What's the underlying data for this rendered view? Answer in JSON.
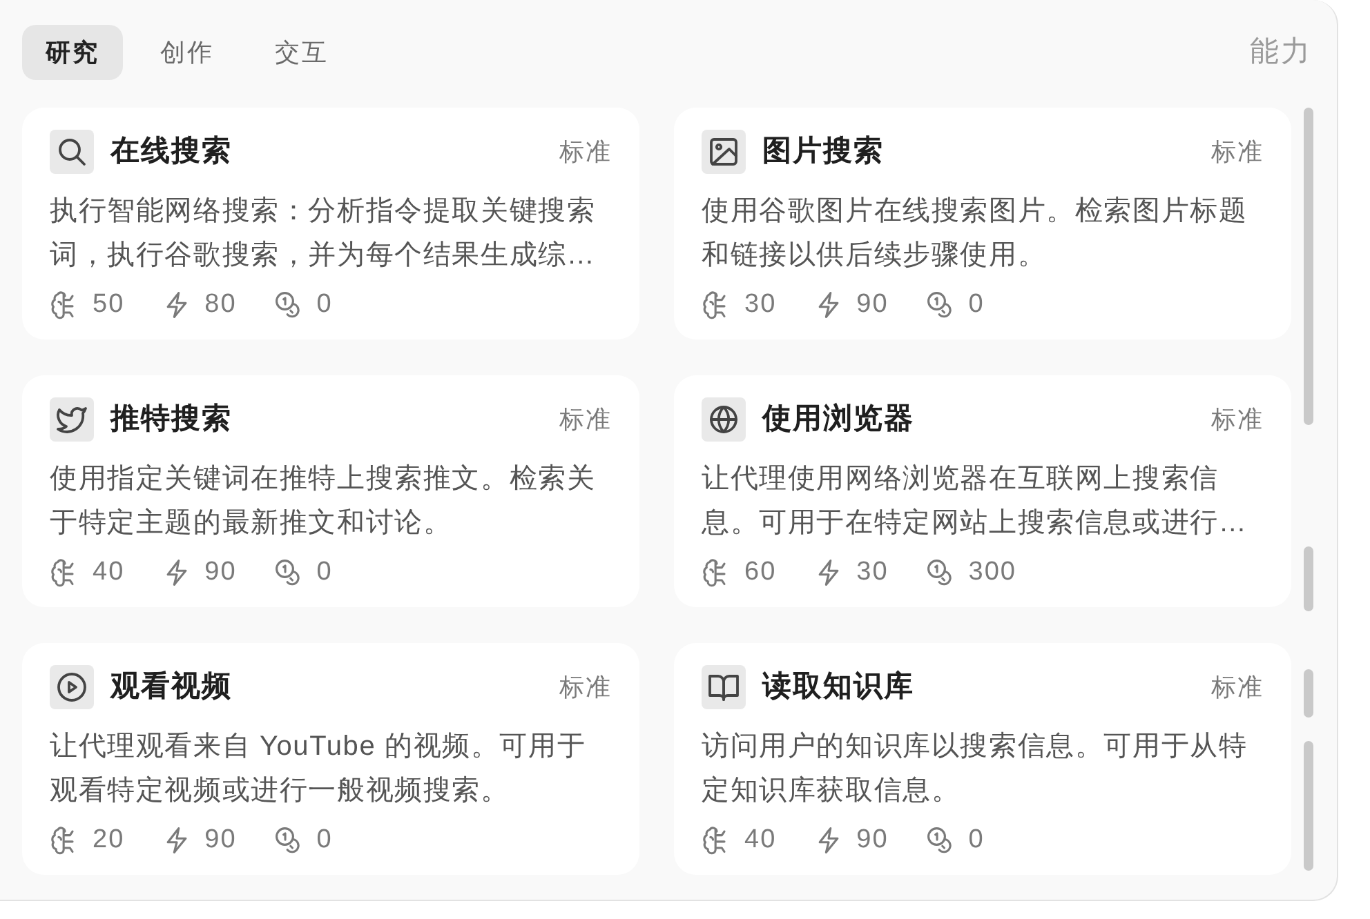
{
  "tabs": [
    {
      "label": "研究",
      "selected": true
    },
    {
      "label": "创作",
      "selected": false
    },
    {
      "label": "交互",
      "selected": false
    }
  ],
  "section_label": "能力",
  "cards": [
    {
      "title": "在线搜索",
      "badge": "标准",
      "description": "执行智能网络搜索：分析指令提取关键搜索词，执行谷歌搜索，并为每个结果生成综…",
      "stats": [
        "50",
        "80",
        "0"
      ]
    },
    {
      "title": "图片搜索",
      "badge": "标准",
      "description": "使用谷歌图片在线搜索图片。检索图片标题和链接以供后续步骤使用。",
      "stats": [
        "30",
        "90",
        "0"
      ]
    },
    {
      "title": "推特搜索",
      "badge": "标准",
      "description": "使用指定关键词在推特上搜索推文。检索关于特定主题的最新推文和讨论。",
      "stats": [
        "40",
        "90",
        "0"
      ]
    },
    {
      "title": "使用浏览器",
      "badge": "标准",
      "description": "让代理使用网络浏览器在互联网上搜索信息。可用于在特定网站上搜索信息或进行…",
      "stats": [
        "60",
        "30",
        "300"
      ]
    },
    {
      "title": "观看视频",
      "badge": "标准",
      "description": "让代理观看来自 YouTube 的视频。可用于观看特定视频或进行一般视频搜索。",
      "stats": [
        "20",
        "90",
        "0"
      ]
    },
    {
      "title": "读取知识库",
      "badge": "标准",
      "description": "访问用户的知识库以搜索信息。可用于从特定知识库获取信息。",
      "stats": [
        "40",
        "90",
        "0"
      ]
    }
  ]
}
